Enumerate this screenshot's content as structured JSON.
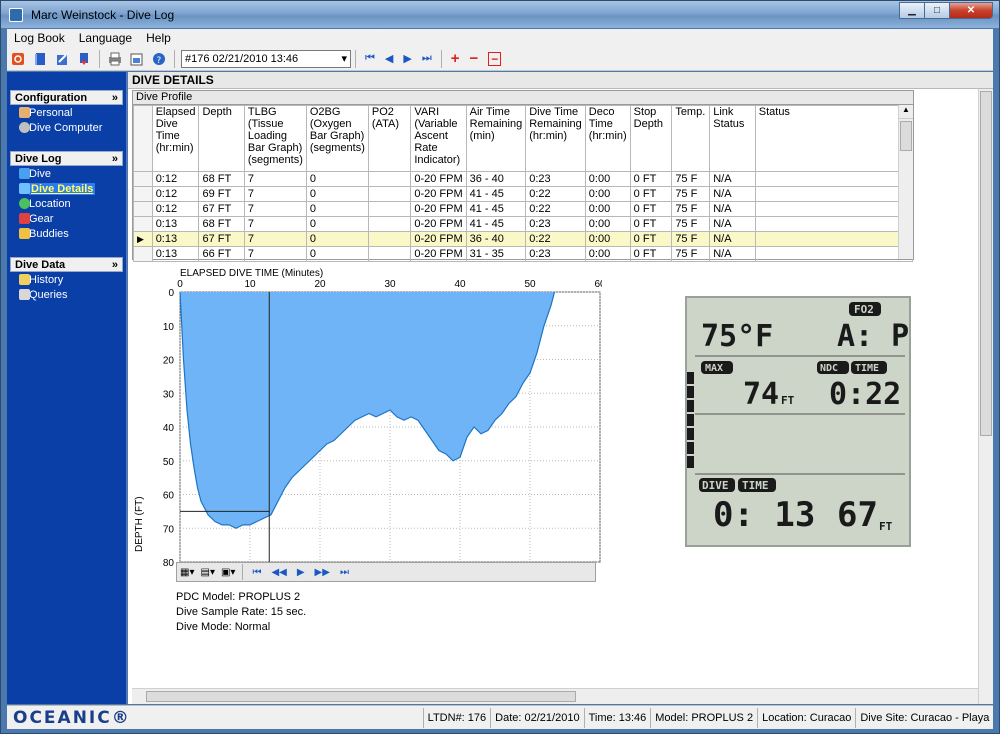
{
  "window": {
    "title": "Marc Weinstock - Dive Log",
    "min": "▁",
    "max": "□",
    "close": "✕"
  },
  "menu": [
    "Log Book",
    "Language",
    "Help"
  ],
  "toolbar": {
    "dive_selector": "#176 02/21/2010 13:46"
  },
  "sidebar": {
    "sections": [
      {
        "title": "Configuration",
        "items": [
          "Personal",
          "Dive Computer"
        ]
      },
      {
        "title": "Dive Log",
        "items": [
          "Dive",
          "Dive Details",
          "Location",
          "Gear",
          "Buddies"
        ]
      },
      {
        "title": "Dive Data",
        "items": [
          "History",
          "Queries"
        ]
      }
    ],
    "selected": "Dive Details"
  },
  "main": {
    "title": "DIVE DETAILS",
    "grid_caption": "Dive Profile"
  },
  "table": {
    "columns": [
      "Elapsed Dive Time (hr:min)",
      "Depth",
      "TLBG (Tissue Loading Bar Graph) (segments)",
      "O2BG (Oxygen Bar Graph) (segments)",
      "PO2 (ATA)",
      "VARI (Variable Ascent Rate Indicator)",
      "Air Time Remaining (min)",
      "Dive Time Remaining (hr:min)",
      "Deco Time (hr:min)",
      "Stop Depth",
      "Temp.",
      "Link Status",
      "Status"
    ],
    "rows": [
      [
        "0:12",
        "68 FT",
        "7",
        "0",
        "",
        "0-20 FPM",
        "36 - 40",
        "0:23",
        "0:00",
        "0 FT",
        "75 F",
        "N/A",
        ""
      ],
      [
        "0:12",
        "69 FT",
        "7",
        "0",
        "",
        "0-20 FPM",
        "41 - 45",
        "0:22",
        "0:00",
        "0 FT",
        "75 F",
        "N/A",
        ""
      ],
      [
        "0:12",
        "67 FT",
        "7",
        "0",
        "",
        "0-20 FPM",
        "41 - 45",
        "0:22",
        "0:00",
        "0 FT",
        "75 F",
        "N/A",
        ""
      ],
      [
        "0:13",
        "68 FT",
        "7",
        "0",
        "",
        "0-20 FPM",
        "41 - 45",
        "0:23",
        "0:00",
        "0 FT",
        "75 F",
        "N/A",
        ""
      ],
      [
        "0:13",
        "67 FT",
        "7",
        "0",
        "",
        "0-20 FPM",
        "36 - 40",
        "0:22",
        "0:00",
        "0 FT",
        "75 F",
        "N/A",
        ""
      ],
      [
        "0:13",
        "66 FT",
        "7",
        "0",
        "",
        "0-20 FPM",
        "31 - 35",
        "0:23",
        "0:00",
        "0 FT",
        "75 F",
        "N/A",
        ""
      ]
    ],
    "current_row": 4
  },
  "chart_data": {
    "type": "area",
    "title": "ELAPSED DIVE TIME (Minutes)",
    "xlabel": "",
    "ylabel": "DEPTH (FT)",
    "xlim": [
      0,
      60
    ],
    "ylim": [
      0,
      80
    ],
    "y_inverted": true,
    "x_ticks": [
      0,
      10,
      20,
      30,
      40,
      50,
      60
    ],
    "y_ticks": [
      0,
      10,
      20,
      30,
      40,
      50,
      60,
      70,
      80
    ],
    "fill_color": "#6fb4f6",
    "line_color": "#1e74c4",
    "cursor": {
      "x": 12.75,
      "y": 65
    },
    "x": [
      0,
      0.5,
      1,
      1.5,
      2,
      2.5,
      3,
      4,
      5,
      6,
      7,
      8,
      9,
      10,
      11,
      12,
      13,
      14,
      15,
      16,
      17,
      18,
      19,
      20,
      21,
      22,
      23,
      24,
      25,
      26,
      27,
      28,
      29,
      30,
      31,
      32,
      33,
      34,
      35,
      36,
      37,
      38,
      39,
      40,
      41,
      42,
      43,
      44,
      45,
      46,
      47,
      48,
      49,
      50,
      51,
      52,
      53,
      53.5
    ],
    "y": [
      0,
      20,
      35,
      45,
      52,
      58,
      62,
      66,
      68,
      69,
      69,
      70,
      69,
      69,
      68,
      67,
      66,
      62,
      58,
      55,
      53,
      51,
      49,
      47,
      45,
      44,
      42,
      40,
      38,
      37,
      36,
      37,
      36,
      35,
      37,
      38,
      37,
      38,
      41,
      44,
      47,
      48,
      50,
      49,
      43,
      40,
      42,
      41,
      38,
      36,
      33,
      31,
      27,
      24,
      18,
      10,
      4,
      0
    ]
  },
  "chart_toolbar": [
    "▾",
    "▾",
    "▾",
    "⏮",
    "◀◀",
    "▶",
    "▶▶",
    "⏭"
  ],
  "info": [
    "PDC Model: PROPLUS 2",
    "Dive Sample Rate: 15 sec.",
    "Dive Mode: Normal"
  ],
  "lcd": {
    "fo2_label": "FO2",
    "temp": "75°F",
    "fo2_value": "A: P",
    "max_label": "MAX",
    "ndc_label": "NDC",
    "time_label": "TIME",
    "max_depth": "74",
    "max_unit": "FT",
    "ndc_time": "0:22",
    "dive_label": "DIVE",
    "dive_time_label": "TIME",
    "dive_time": "0: 13",
    "depth": "67",
    "depth_unit": "FT",
    "bar_segments": 7
  },
  "status": {
    "brand": "OCEANIC®",
    "cells": [
      "LTDN#: 176",
      "Date: 02/21/2010",
      "Time: 13:46",
      "Model: PROPLUS 2",
      "Location: Curacao",
      "Dive Site: Curacao - Playa Lag"
    ]
  },
  "colors": {
    "sidebar": "#0a3fa8",
    "selected_text": "#ffff66",
    "selected_row": "#fbf8c8",
    "lcd": "#cdd4c8"
  }
}
